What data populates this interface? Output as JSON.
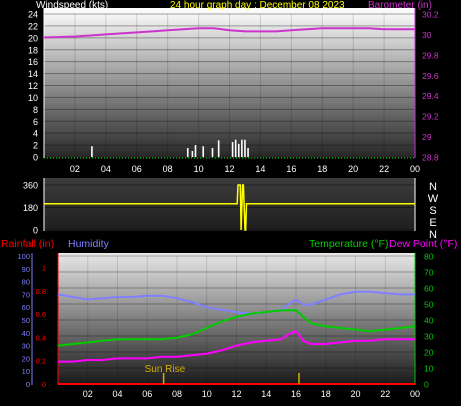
{
  "title": "24 hour graph day : December 08 2023",
  "colors": {
    "wind": "#ffffff",
    "baro": "#cc33cc",
    "dir": "#ffff00",
    "rain": "#ff0000",
    "humidity": "#8080ff",
    "temp": "#00cc00",
    "dew": "#ff00ff",
    "sunrise": "#d4b000",
    "label_humidity": "#8080ff",
    "label_temp": "#00cc00",
    "label_dew": "#ff00ff",
    "label_rain": "#ff0000"
  },
  "chart_data": [
    {
      "type": "bar",
      "name": "wind-baro",
      "ylabel": "Windspeed (kts)",
      "y2label": "Barometer (in)",
      "ylim": [
        0,
        24
      ],
      "y2lim": [
        28.8,
        30.2
      ],
      "yticks": [
        "0",
        "2",
        "4",
        "6",
        "8",
        "10",
        "12",
        "14",
        "16",
        "18",
        "20",
        "22",
        "24"
      ],
      "y2ticks": [
        "28.8",
        "29",
        "29.2",
        "29.4",
        "29.6",
        "29.8",
        "30",
        "30.2"
      ],
      "xticks": [
        "02",
        "04",
        "06",
        "08",
        "10",
        "12",
        "14",
        "16",
        "18",
        "20",
        "22",
        "00"
      ],
      "xlim": [
        0,
        24
      ],
      "wind": [
        {
          "x": 3.1,
          "v": 1.8
        },
        {
          "x": 9.3,
          "v": 1.5
        },
        {
          "x": 9.6,
          "v": 1.0
        },
        {
          "x": 9.8,
          "v": 2.0
        },
        {
          "x": 10.3,
          "v": 1.8
        },
        {
          "x": 10.9,
          "v": 1.5
        },
        {
          "x": 11.3,
          "v": 2.8
        },
        {
          "x": 12.2,
          "v": 2.5
        },
        {
          "x": 12.4,
          "v": 2.9
        },
        {
          "x": 12.6,
          "v": 2.2
        },
        {
          "x": 12.8,
          "v": 2.9
        },
        {
          "x": 13.0,
          "v": 2.9
        },
        {
          "x": 13.2,
          "v": 1.5
        }
      ],
      "baro": {
        "x": [
          0,
          1,
          2,
          3,
          4,
          5,
          6,
          7,
          8,
          9,
          10,
          11,
          12,
          13,
          14,
          15,
          16,
          17,
          18,
          19,
          20,
          21,
          22,
          23,
          24
        ],
        "y": [
          29.97,
          29.975,
          29.98,
          29.99,
          30.0,
          30.01,
          30.02,
          30.03,
          30.04,
          30.05,
          30.06,
          30.06,
          30.04,
          30.03,
          30.03,
          30.03,
          30.04,
          30.05,
          30.06,
          30.06,
          30.06,
          30.06,
          30.05,
          30.05,
          30.05
        ]
      }
    },
    {
      "type": "line",
      "name": "wind-direction",
      "ylim": [
        0,
        360
      ],
      "yticks": [
        "0",
        "180",
        "360"
      ],
      "compass": [
        "N",
        "W",
        "S",
        "E",
        "N"
      ],
      "x": [
        0,
        12.5,
        12.55,
        12.7,
        12.75,
        12.85,
        12.9,
        13.0,
        13.05,
        13.1,
        24
      ],
      "y": [
        210,
        210,
        360,
        360,
        0,
        360,
        360,
        0,
        0,
        210,
        210
      ]
    },
    {
      "type": "line",
      "name": "temp-humidity-rain",
      "rain_label": "Rainfall (in)",
      "humidity_label": "Humidity",
      "temp_label": "Temperature (°F)",
      "dew_label": "Dew Point (°F)",
      "rain_lim": [
        0,
        1.1
      ],
      "rain_ticks": [
        "0",
        "0.2",
        "0.4",
        "0.6",
        "0.8",
        "1"
      ],
      "hum_lim": [
        0,
        100
      ],
      "hum_ticks": [
        "0",
        "10",
        "20",
        "30",
        "40",
        "50",
        "60",
        "70",
        "80",
        "90",
        "100"
      ],
      "temp_lim": [
        0,
        80
      ],
      "temp_ticks": [
        "0",
        "10",
        "20",
        "30",
        "40",
        "50",
        "60",
        "70",
        "80"
      ],
      "xticks": [
        "02",
        "04",
        "06",
        "08",
        "10",
        "12",
        "14",
        "16",
        "18",
        "20",
        "22",
        "00"
      ],
      "xlim": [
        0,
        24
      ],
      "sunrise_label": "Sun Rise",
      "sunrise_x": 7.1,
      "sunset_x": 16.2,
      "humidity": {
        "x": [
          0,
          1,
          2,
          3,
          4,
          5,
          6,
          7,
          8,
          9,
          10,
          11,
          12,
          13,
          14,
          15,
          15.5,
          16,
          16.5,
          17,
          18,
          19,
          20,
          21,
          22,
          23,
          24
        ],
        "y": [
          70,
          68,
          66,
          67,
          68,
          68,
          69,
          69,
          67,
          64,
          60,
          58,
          56,
          55,
          56,
          58,
          62,
          66,
          62,
          62,
          66,
          70,
          72,
          72,
          71,
          70,
          70
        ]
      },
      "temp": {
        "x": [
          0,
          1,
          2,
          3,
          4,
          5,
          6,
          7,
          8,
          9,
          10,
          11,
          12,
          13,
          14,
          15,
          16,
          16.5,
          17,
          18,
          19,
          20,
          21,
          22,
          23,
          24
        ],
        "y": [
          24,
          25,
          26,
          27,
          28,
          28,
          28,
          28,
          29,
          31,
          35,
          39,
          42,
          44,
          45,
          46,
          46,
          42,
          38,
          36,
          35,
          34,
          33,
          34,
          35,
          36
        ]
      },
      "dew": {
        "x": [
          0,
          1,
          2,
          3,
          4,
          5,
          6,
          7,
          8,
          9,
          10,
          11,
          12,
          13,
          14,
          15,
          15.5,
          16,
          16.5,
          17,
          18,
          19,
          20,
          21,
          22,
          23,
          24
        ],
        "y": [
          14,
          14,
          15,
          15,
          16,
          16,
          16,
          17,
          17,
          18,
          19,
          21,
          24,
          26,
          27,
          28,
          31,
          33,
          27,
          25,
          25,
          26,
          27,
          27,
          28,
          28,
          28
        ]
      },
      "rain": {
        "x": [
          0,
          24
        ],
        "y": [
          0,
          0
        ]
      }
    }
  ]
}
